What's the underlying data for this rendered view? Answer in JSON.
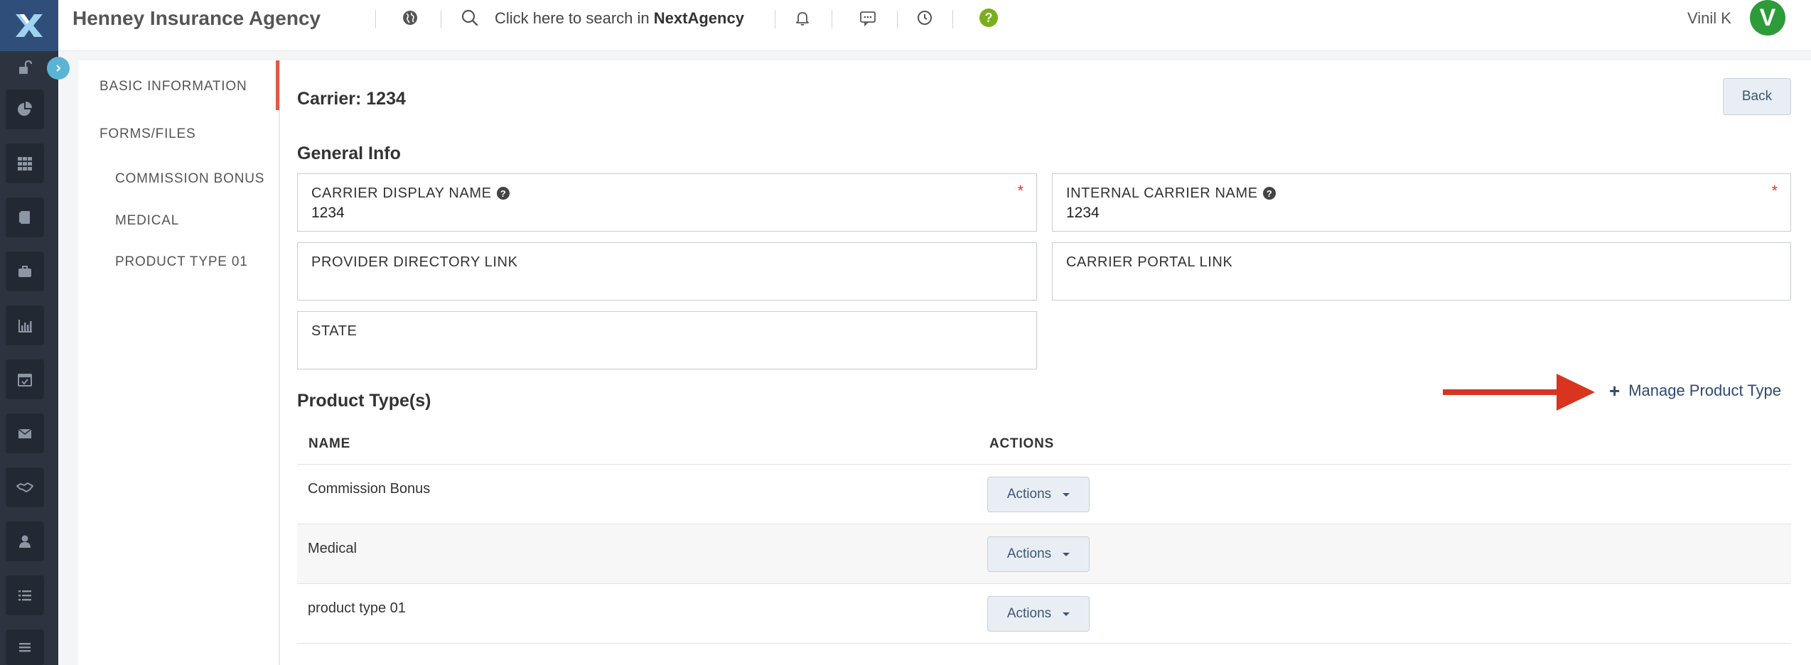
{
  "header": {
    "app_title": "Henney Insurance Agency",
    "search_prefix": "Click here to search in",
    "search_brand": "NextAgency",
    "user_name": "Vinil K",
    "avatar_initial": "V"
  },
  "sidebar": {
    "icons": [
      "unlock-icon",
      "pie-chart-icon",
      "grid-icon",
      "book-icon",
      "briefcase-icon",
      "bar-chart-icon",
      "calendar-check-icon",
      "mail-icon",
      "handshake-icon",
      "user-icon",
      "list-icon",
      "menu-icon"
    ]
  },
  "inner_nav": {
    "items": [
      "BASIC INFORMATION",
      "FORMS/FILES",
      "COMMISSION BONUS",
      "MEDICAL",
      "PRODUCT TYPE 01"
    ]
  },
  "main": {
    "carrier_title": "Carrier: 1234",
    "back_label": "Back",
    "general_info_title": "General Info",
    "fields": {
      "carrier_display_name": {
        "label": "CARRIER DISPLAY NAME",
        "value": "1234",
        "required": "*"
      },
      "internal_carrier_name": {
        "label": "INTERNAL CARRIER NAME",
        "value": "1234",
        "required": "*"
      },
      "provider_directory_link": {
        "label": "PROVIDER DIRECTORY LINK",
        "value": ""
      },
      "carrier_portal_link": {
        "label": "CARRIER PORTAL LINK",
        "value": ""
      },
      "state": {
        "label": "STATE",
        "value": ""
      }
    },
    "product_types_title": "Product Type(s)",
    "manage_label": "Manage Product Type",
    "table": {
      "headers": [
        "NAME",
        "ACTIONS"
      ],
      "rows": [
        {
          "name": "Commission Bonus",
          "action": "Actions"
        },
        {
          "name": "Medical",
          "action": "Actions"
        },
        {
          "name": "product type 01",
          "action": "Actions"
        }
      ]
    }
  },
  "colors": {
    "brand_navy": "#2f4f7a",
    "sidebar": "#2d3440",
    "accent_red": "#e05a45",
    "link_blue": "#2c4a6e",
    "avatar_green": "#2e9b3a",
    "annotation_arrow": "#d8341f"
  }
}
